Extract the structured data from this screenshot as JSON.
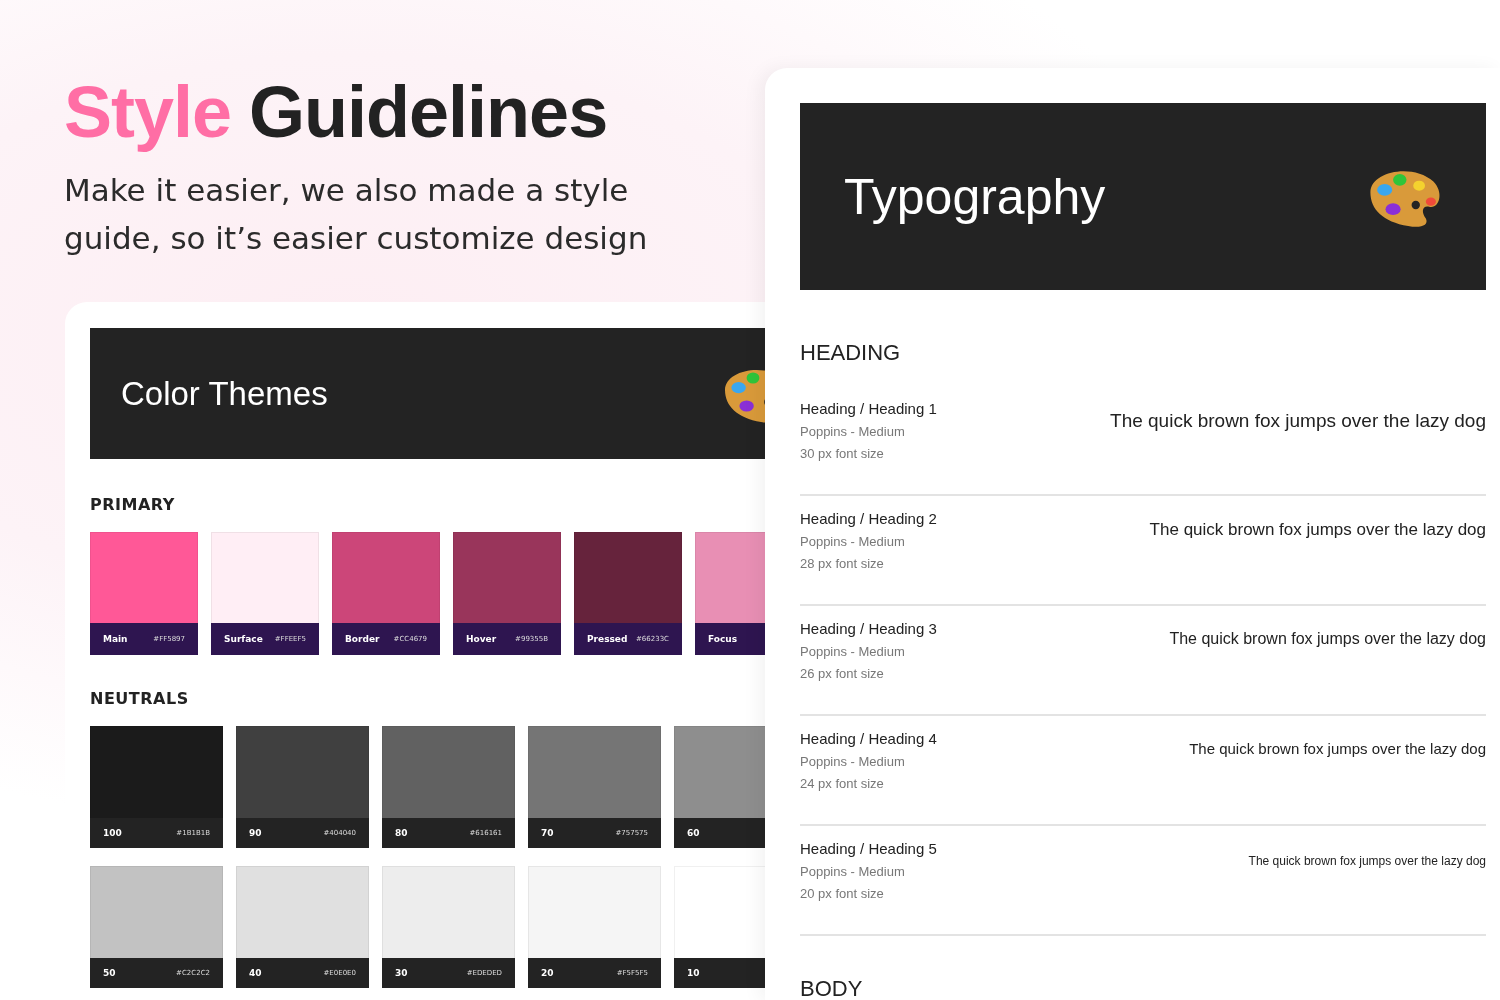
{
  "hero": {
    "title_accent": "Style",
    "title_rest": "Guidelines",
    "subtitle": "Make  it easier, we also made a style guide, so it’s easier customize design"
  },
  "color_card": {
    "title": "Color Themes",
    "primary": {
      "label": "PRIMARY",
      "swatches": [
        {
          "name": "Main",
          "hex": "#FF5897",
          "color": "#ff5897"
        },
        {
          "name": "Surface",
          "hex": "#FFEEF5",
          "color": "#ffeef5"
        },
        {
          "name": "Border",
          "hex": "#CC4679",
          "color": "#cc4679"
        },
        {
          "name": "Hover",
          "hex": "#99355B",
          "color": "#99355b"
        },
        {
          "name": "Pressed",
          "hex": "#66233C",
          "color": "#66233c"
        },
        {
          "name": "Focus",
          "color": "#e88fb4"
        }
      ]
    },
    "neutrals": {
      "label": "NEUTRALS",
      "rows": [
        [
          {
            "name": "100",
            "hex": "#1B1B1B",
            "color": "#1b1b1b"
          },
          {
            "name": "90",
            "hex": "#404040",
            "color": "#404040"
          },
          {
            "name": "80",
            "hex": "#616161",
            "color": "#616161"
          },
          {
            "name": "70",
            "hex": "#757575",
            "color": "#757575"
          },
          {
            "name": "60",
            "color": "#8e8e8e"
          }
        ],
        [
          {
            "name": "50",
            "hex": "#C2C2C2",
            "color": "#c2c2c2"
          },
          {
            "name": "40",
            "hex": "#E0E0E0",
            "color": "#e0e0e0"
          },
          {
            "name": "30",
            "hex": "#EDEDED",
            "color": "#ededed"
          },
          {
            "name": "20",
            "hex": "#F5F5F5",
            "color": "#f5f5f5"
          },
          {
            "name": "10",
            "color": "#ffffff"
          }
        ]
      ]
    }
  },
  "type_card": {
    "title": "Typography",
    "section": "HEADING",
    "headings": [
      {
        "name": "Heading / Heading 1",
        "font": "Poppins -  Medium",
        "size": "30 px font size",
        "sample": "The quick brown fox jumps over the lazy dog"
      },
      {
        "name": "Heading / Heading 2",
        "font": "Poppins -  Medium",
        "size": "28 px font size",
        "sample": "The quick brown fox jumps over the lazy dog"
      },
      {
        "name": "Heading / Heading 3",
        "font": "Poppins -  Medium",
        "size": "26 px font size",
        "sample": "The quick brown fox jumps over the lazy dog"
      },
      {
        "name": "Heading / Heading 4",
        "font": "Poppins -  Medium",
        "size": "24 px font size",
        "sample": "The quick brown fox jumps over the lazy dog"
      },
      {
        "name": "Heading / Heading 5",
        "font": "Poppins -  Medium",
        "size": "20 px font size",
        "sample": "The quick brown fox jumps over the lazy dog"
      }
    ],
    "next_section": "BODY"
  }
}
